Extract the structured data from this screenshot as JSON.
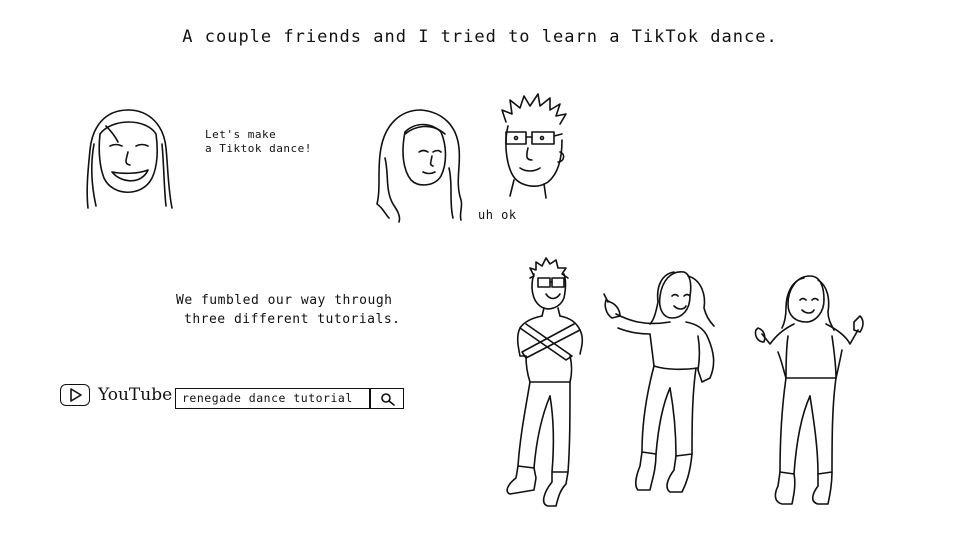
{
  "title": "A couple friends and I tried to learn a TikTok dance.",
  "speech": {
    "line1": "Let's make",
    "line2": "a Tiktok dance!"
  },
  "reply": "uh ok",
  "caption": {
    "line1": "We fumbled our way through",
    "line2": "three different tutorials."
  },
  "youtube": {
    "brand": "YouTube",
    "icons": [
      "play-icon",
      "search-icon"
    ]
  },
  "search": {
    "value": "renegade dance tutorial"
  },
  "colors": {
    "ink": "#111111",
    "paper": "#ffffff"
  }
}
